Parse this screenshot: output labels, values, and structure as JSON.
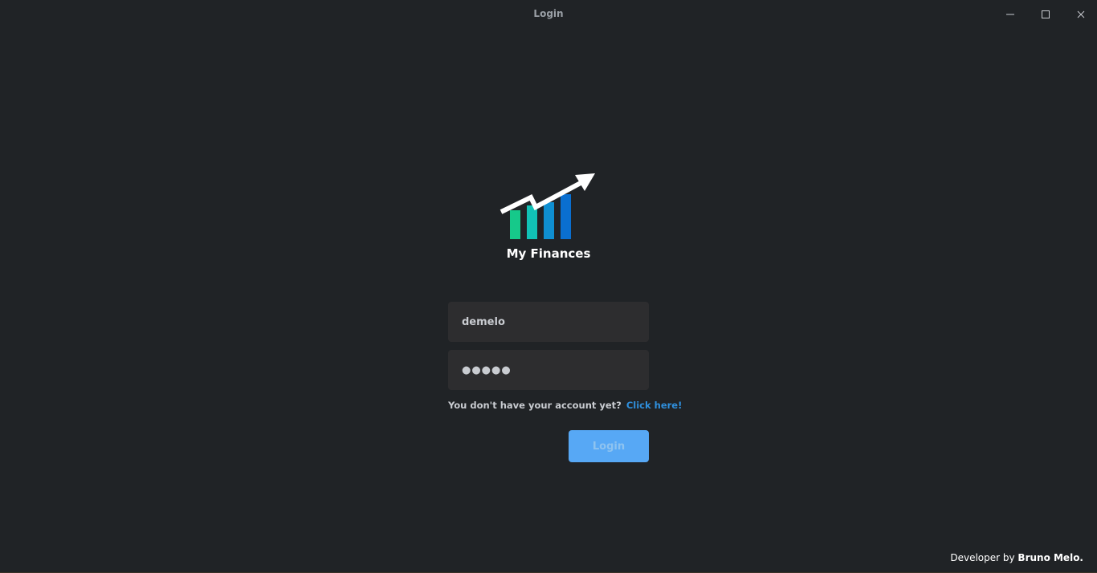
{
  "window": {
    "title": "Login",
    "controls": {
      "minimize_icon": "minimize-icon",
      "maximize_icon": "maximize-icon",
      "close_icon": "close-icon"
    }
  },
  "branding": {
    "app_name": "My Finances",
    "logo_icon": "finance-chart-logo",
    "logo_colors": [
      "#16c98a",
      "#11c2b6",
      "#0f8fd1",
      "#0a6fd0"
    ]
  },
  "form": {
    "username": {
      "value": "demelo"
    },
    "password": {
      "value": "●●●●●"
    },
    "signup_prompt": "You don't have your account yet?",
    "signup_link": "Click here!",
    "login_label": "Login"
  },
  "footer": {
    "developer_prefix": "Developer by",
    "developer_name": "Bruno Melo."
  },
  "colors": {
    "background": "#202326",
    "field_background": "#2d2d2f",
    "accent": "#57a8f5",
    "link": "#2f8fdc"
  }
}
